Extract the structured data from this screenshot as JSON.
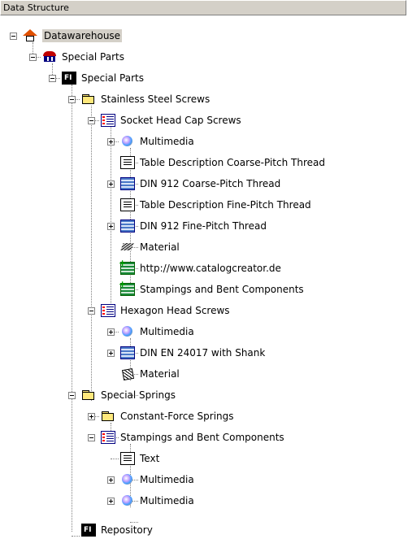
{
  "header": {
    "title": "Data Structure"
  },
  "tree": {
    "root": "Datawarehouse",
    "special_parts_group": "Special Parts",
    "special_parts": "Special Parts",
    "stainless_steel_screws": "Stainless Steel Screws",
    "socket_head_cap_screws": "Socket Head Cap Screws",
    "shcs_multimedia": "Multimedia",
    "shcs_table_desc_coarse": "Table Description Coarse-Pitch Thread",
    "shcs_din912_coarse": "DIN 912 Coarse-Pitch Thread",
    "shcs_table_desc_fine": "Table Description Fine-Pitch Thread",
    "shcs_din912_fine": "DIN 912 Fine-Pitch Thread",
    "shcs_material": "Material",
    "shcs_link": "http://www.catalogcreator.de",
    "shcs_stampings": "Stampings and Bent Components",
    "hexagon_head_screws": "Hexagon Head Screws",
    "hhs_multimedia": "Multimedia",
    "hhs_din_en": "DIN EN 24017 with Shank",
    "hhs_material": "Material",
    "special_springs": "Special Springs",
    "constant_force_springs": "Constant-Force Springs",
    "stampings_bent": "Stampings and Bent Components",
    "sbc_text": "Text",
    "sbc_multimedia_1": "Multimedia",
    "sbc_multimedia_2": "Multimedia",
    "repository": "Repository"
  },
  "icons": {
    "root": "house-icon",
    "group": "parts-group-icon",
    "catalog": "fi-catalog-icon",
    "folder": "folder-icon",
    "list": "list-icon",
    "table": "table-icon",
    "table_description": "table-description-icon",
    "multimedia": "multimedia-icon",
    "material": "material-icon",
    "link": "link-icon"
  }
}
